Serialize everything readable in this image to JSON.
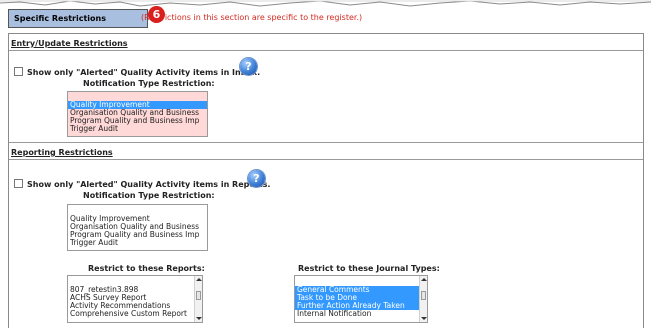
{
  "header": {
    "title": "Specific Restrictions",
    "badge": "6",
    "note": "(Restrictions in this section are specific to the register.)"
  },
  "entry": {
    "section_title": "Entry/Update Restrictions",
    "checkbox_label": "Show only \"Alerted\" Quality Activity items in Inbox.",
    "help_icon": "?",
    "notification_label": "Notification Type Restriction:",
    "notification_options": [
      {
        "label": "Quality Improvement",
        "selected": true
      },
      {
        "label": "Organisation Quality and Business",
        "selected": false
      },
      {
        "label": "Program Quality and Business Imp",
        "selected": false
      },
      {
        "label": "Trigger Audit",
        "selected": false
      }
    ]
  },
  "reporting": {
    "section_title": "Reporting Restrictions",
    "checkbox_label": "Show only \"Alerted\" Quality Activity items in Reports.",
    "help_icon": "?",
    "notification_label": "Notification Type Restriction:",
    "notification_options": [
      {
        "label": "Quality Improvement"
      },
      {
        "label": "Organisation Quality and Business"
      },
      {
        "label": "Program Quality and Business Imp"
      },
      {
        "label": "Trigger Audit"
      }
    ],
    "reports_label": "Restrict to these Reports:",
    "reports_options": [
      {
        "label": "807_retestin3.898"
      },
      {
        "label": "ACHS Survey Report"
      },
      {
        "label": "Activity Recommendations"
      },
      {
        "label": "Comprehensive Custom Report"
      }
    ],
    "journal_label": "Restrict to these Journal Types:",
    "journal_options": [
      {
        "label": "General Comments",
        "selected": true
      },
      {
        "label": "Task to be Done",
        "selected": true
      },
      {
        "label": "Further Action Already Taken",
        "selected": true
      },
      {
        "label": "Internal Notification",
        "selected": false
      }
    ]
  },
  "colors": {
    "header_bg": "#a9bfe0",
    "note_red": "#d42a21",
    "selection_blue": "#3399ff",
    "pink_listbox": "#ffd8d8"
  }
}
